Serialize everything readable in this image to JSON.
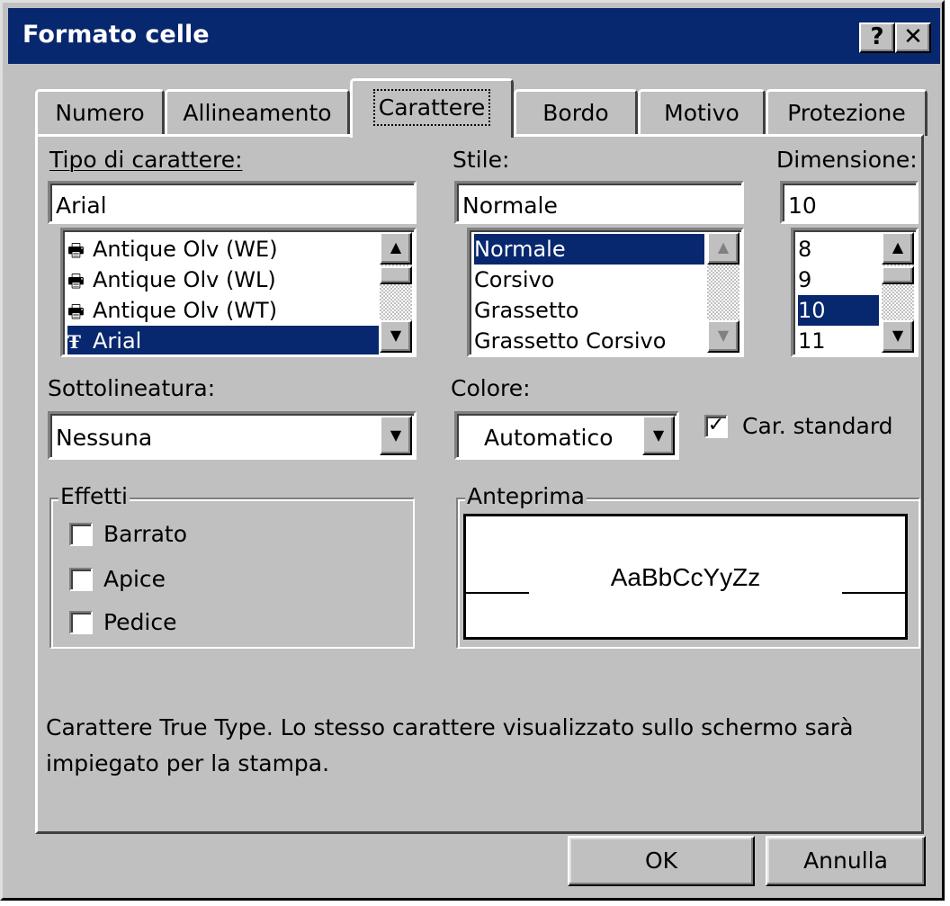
{
  "window": {
    "title": "Formato celle",
    "help_label": "?",
    "close_label": "✕"
  },
  "tabs": [
    {
      "label": "Numero"
    },
    {
      "label": "Allineamento"
    },
    {
      "label": "Carattere",
      "active": true
    },
    {
      "label": "Bordo"
    },
    {
      "label": "Motivo"
    },
    {
      "label": "Protezione"
    }
  ],
  "font": {
    "label": "Tipo di carattere:",
    "value": "Arial",
    "list": [
      {
        "name": "Antique Olv (WE)",
        "icon": "printer-font-icon"
      },
      {
        "name": "Antique Olv (WL)",
        "icon": "printer-font-icon"
      },
      {
        "name": "Antique Olv (WT)",
        "icon": "printer-font-icon"
      },
      {
        "name": "Arial",
        "icon": "truetype-icon",
        "selected": true
      }
    ]
  },
  "style": {
    "label": "Stile:",
    "value": "Normale",
    "list": [
      {
        "name": "Normale",
        "selected": true
      },
      {
        "name": "Corsivo"
      },
      {
        "name": "Grassetto"
      },
      {
        "name": "Grassetto Corsivo"
      }
    ]
  },
  "size": {
    "label": "Dimensione:",
    "value": "10",
    "list": [
      {
        "name": "8"
      },
      {
        "name": "9"
      },
      {
        "name": "10",
        "selected": true
      },
      {
        "name": "11"
      }
    ]
  },
  "underline": {
    "label": "Sottolineatura:",
    "value": "Nessuna"
  },
  "color": {
    "label": "Colore:",
    "value": "Automatico"
  },
  "standard_font": {
    "label": "Car. standard",
    "checked": true
  },
  "effects": {
    "title": "Effetti",
    "items": [
      {
        "label": "Barrato",
        "checked": false
      },
      {
        "label": "Apice",
        "checked": false
      },
      {
        "label": "Pedice",
        "checked": false
      }
    ]
  },
  "preview": {
    "title": "Anteprima",
    "sample": "AaBbCcYyZz"
  },
  "info_text": "Carattere True Type. Lo stesso carattere visualizzato sullo schermo sarà impiegato per la stampa.",
  "buttons": {
    "ok": "OK",
    "cancel": "Annulla"
  },
  "colors": {
    "titlebar": "#07276e",
    "face": "#c0c0c0",
    "selection": "#07276e"
  }
}
